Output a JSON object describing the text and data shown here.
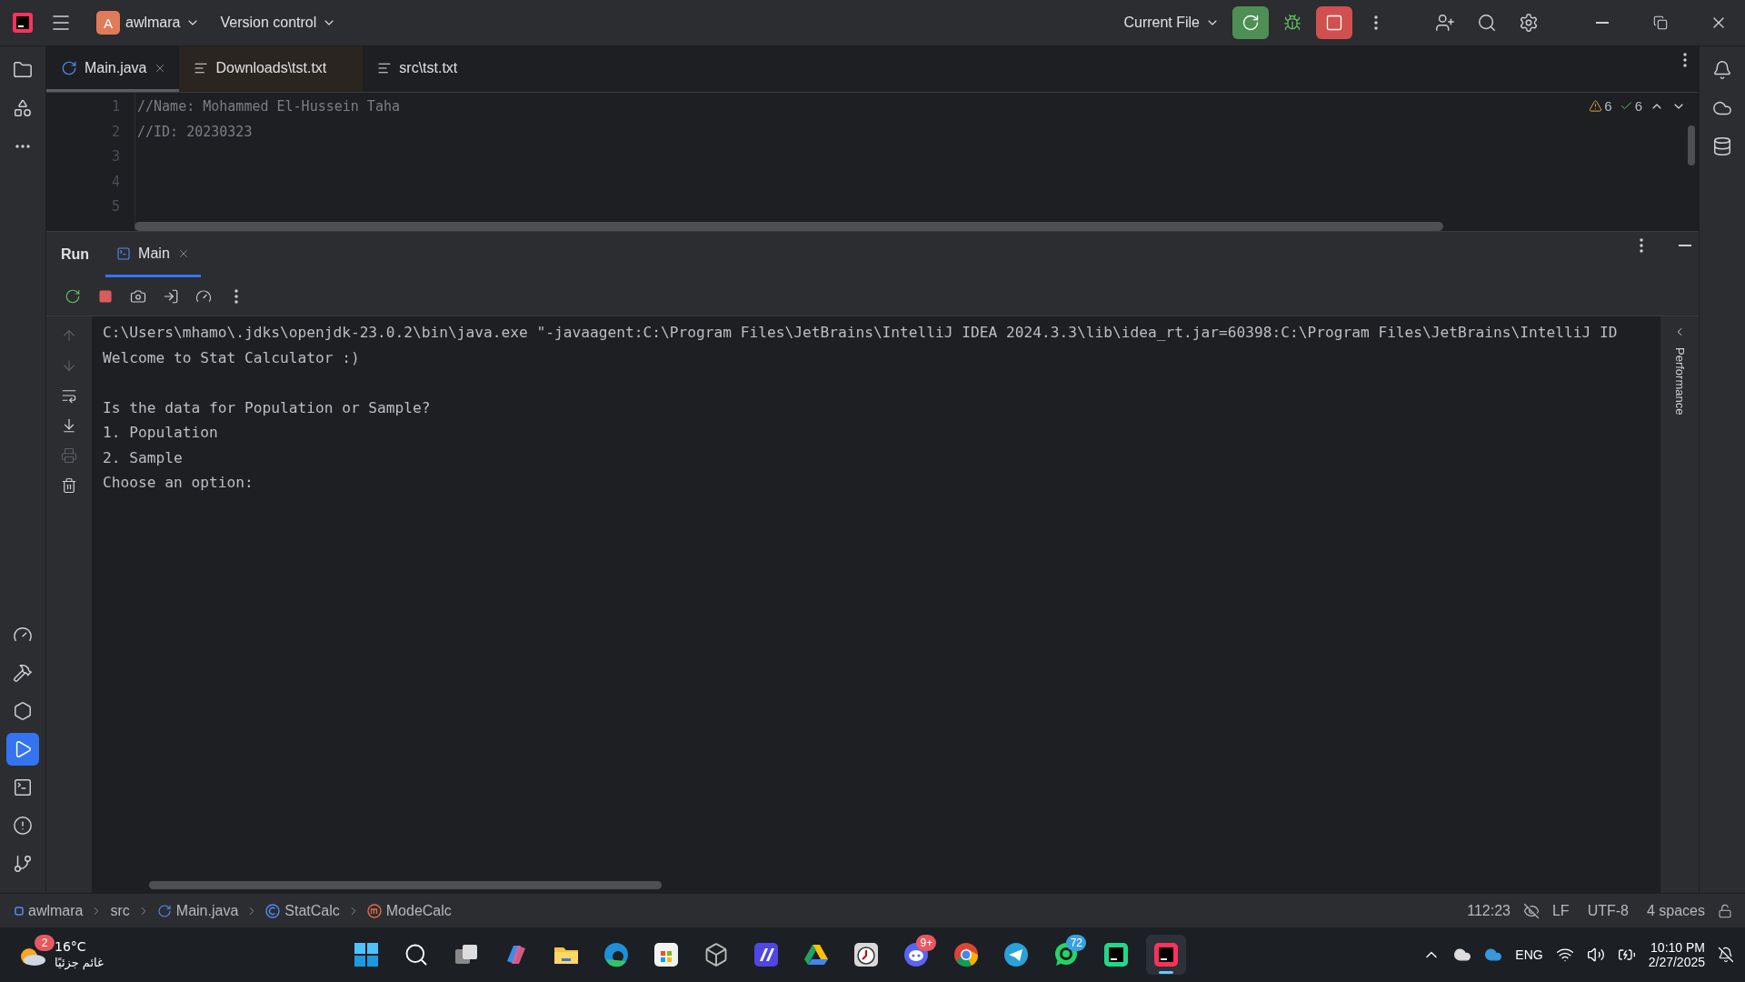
{
  "title_bar": {
    "project_initial": "A",
    "project": "awlmara",
    "vcs": "Version control",
    "run_config": "Current File"
  },
  "left_tools": [
    {
      "kind": "project",
      "selected": false
    },
    {
      "kind": "structure",
      "selected": false
    },
    {
      "kind": "more",
      "selected": false
    },
    {
      "kind": "profiler",
      "selected": false
    },
    {
      "kind": "build",
      "selected": false
    },
    {
      "kind": "services",
      "selected": false
    },
    {
      "kind": "run",
      "selected": true
    },
    {
      "kind": "terminal",
      "selected": false
    },
    {
      "kind": "problems",
      "selected": false
    },
    {
      "kind": "git",
      "selected": false
    }
  ],
  "editor_tabs": [
    {
      "label": "Main.java",
      "kind": "java",
      "selected": true,
      "closable": true,
      "highlighted": false
    },
    {
      "label": "Downloads\\tst.txt",
      "kind": "text",
      "selected": false,
      "closable": false,
      "highlighted": true
    },
    {
      "label": "src\\tst.txt",
      "kind": "text",
      "selected": false,
      "closable": false,
      "highlighted": false
    }
  ],
  "editor": {
    "warnings": "6",
    "checks": "6",
    "lines": [
      {
        "number": "1",
        "text": "//Name: Mohammed El-Hussein Taha"
      },
      {
        "number": "2",
        "text": "//ID: 20230323"
      },
      {
        "number": "3"
      },
      {
        "number": "4"
      },
      {
        "number": "5"
      }
    ]
  },
  "run_panel": {
    "title": "Run",
    "tabs": [
      {
        "label": "Main",
        "selected": true
      }
    ],
    "side_label": "Performance",
    "console": [
      [
        "C:\\Users\\mhamo\\.jdks\\openjdk-23.0.2\\bin\\java.exe \"-javaagent:C:\\Program Files\\JetBrains\\IntelliJ IDEA 2024.3.3\\lib\\idea_rt.jar=60398:C:\\Program Files\\JetBrains\\IntelliJ ID",
        "Welcome to Stat Calculator :)"
      ],
      [
        "Is the data for Population or Sample?",
        "1. Population",
        "2. Sample",
        "Choose an option:"
      ]
    ]
  },
  "status_bar": {
    "breadcrumbs": [
      {
        "label": "awlmara",
        "kind": "module"
      },
      {
        "label": "src",
        "kind": "folder"
      },
      {
        "label": "Main.java",
        "kind": "java"
      },
      {
        "label": "StatCalc",
        "kind": "class"
      },
      {
        "label": "ModeCalc",
        "kind": "method"
      }
    ],
    "position": "112:23",
    "line_separator": "LF",
    "encoding": "UTF-8",
    "indent": "4 spaces"
  },
  "taskbar": {
    "weather": {
      "badge": "2",
      "temperature": "16°C",
      "condition": "غائم جزئيًا"
    },
    "apps": [
      {
        "kind": "start",
        "selected": false
      },
      {
        "kind": "search",
        "selected": false
      },
      {
        "kind": "taskview",
        "selected": false
      },
      {
        "kind": "copilot",
        "selected": false
      },
      {
        "kind": "explorer",
        "selected": false
      },
      {
        "kind": "edge",
        "selected": false
      },
      {
        "kind": "store",
        "selected": false
      },
      {
        "kind": "unity",
        "selected": false
      },
      {
        "kind": "vscode",
        "selected": false
      },
      {
        "kind": "drive",
        "selected": false
      },
      {
        "kind": "clock",
        "selected": false
      },
      {
        "kind": "discord",
        "selected": false,
        "badge": "9+"
      },
      {
        "kind": "chrome",
        "selected": false
      },
      {
        "kind": "telegram",
        "selected": false
      },
      {
        "kind": "whatsapp",
        "selected": false,
        "badge": "72"
      },
      {
        "kind": "clion",
        "selected": false
      },
      {
        "kind": "intellij",
        "selected": true
      }
    ],
    "language": "ENG",
    "time": "10:10 PM",
    "date": "2/27/2025"
  }
}
